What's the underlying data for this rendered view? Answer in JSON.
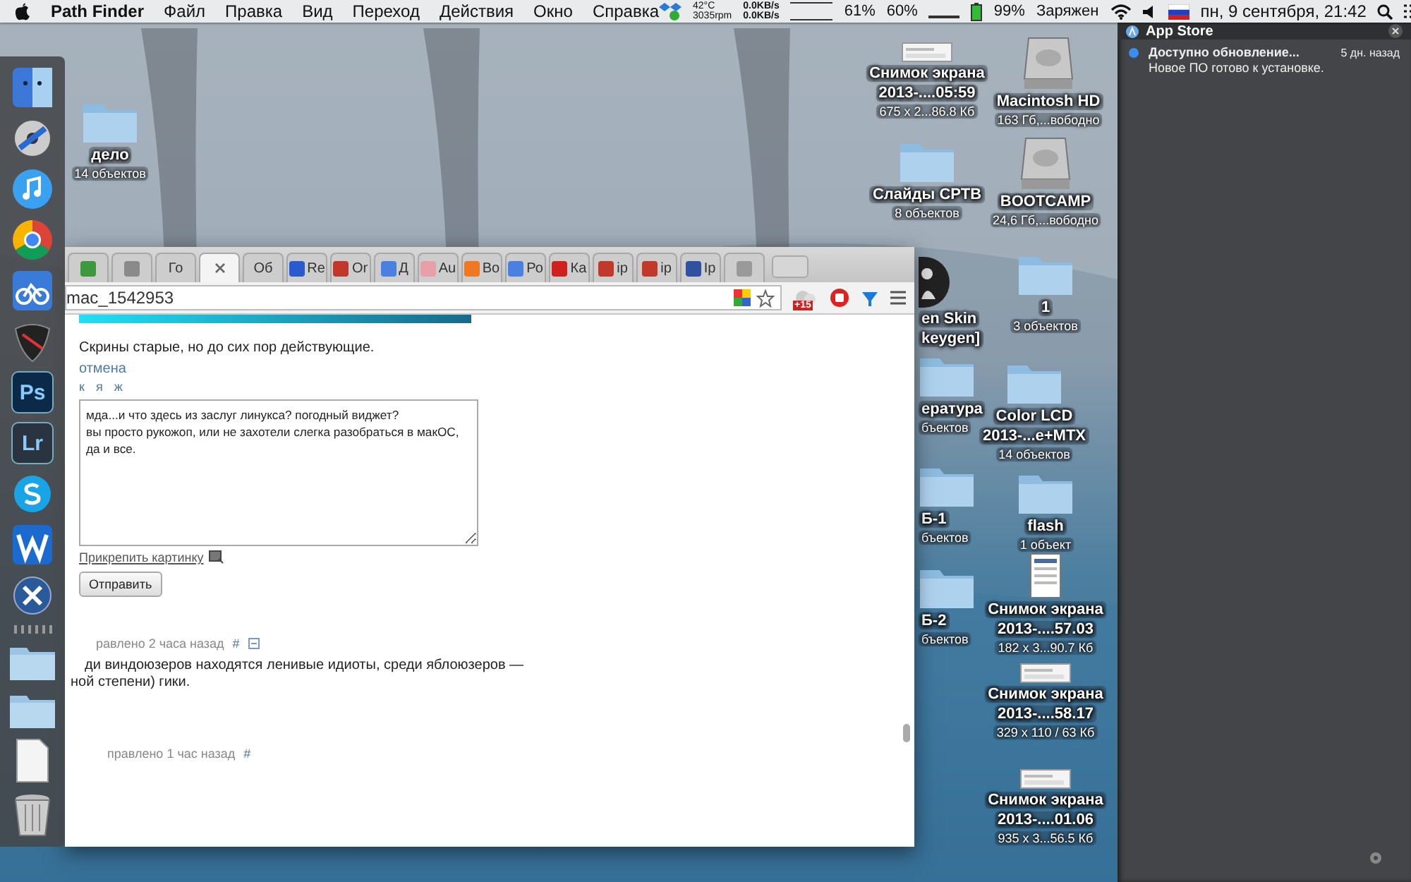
{
  "menubar": {
    "app_name": "Path Finder",
    "menus": [
      "Файл",
      "Правка",
      "Вид",
      "Переход",
      "Действия",
      "Окно",
      "Справка"
    ],
    "status": {
      "temperature": "42°C",
      "fan": "3035rpm",
      "net_up": "0.0KB/s",
      "net_down": "0.0KB/s",
      "disk": "61%",
      "memory": "60%",
      "battery": "99%",
      "battery_state": "Заряжен",
      "clock": "пн, 9 сентября, 21:42"
    }
  },
  "dock": [
    {
      "kind": "finder"
    },
    {
      "kind": "disc"
    },
    {
      "kind": "itunes"
    },
    {
      "kind": "chrome"
    },
    {
      "kind": "bike"
    },
    {
      "kind": "guitar"
    },
    {
      "kind": "letters",
      "glyph": "Ps",
      "color": "#0b2a4a"
    },
    {
      "kind": "letters",
      "glyph": "Lr",
      "color": "#2a3440"
    },
    {
      "kind": "skype"
    },
    {
      "kind": "wave"
    },
    {
      "kind": "xcircle"
    },
    {
      "kind": "separator"
    },
    {
      "kind": "folder"
    },
    {
      "kind": "folder"
    },
    {
      "kind": "file"
    },
    {
      "kind": "trash"
    }
  ],
  "desktop_icons": [
    {
      "kind": "folder",
      "name_lines": [
        "дело"
      ],
      "info": "14 объектов"
    },
    {
      "kind": "screenshot",
      "name_lines": [
        "Снимок экрана",
        "2013-....05:59"
      ],
      "info": "675 x 2...86.8 Кб"
    },
    {
      "kind": "drive",
      "name_lines": [
        "Macintosh HD"
      ],
      "info": "163 Гб,...вободно"
    },
    {
      "kind": "folder",
      "name_lines": [
        "Слайды СРТВ"
      ],
      "info": "8 объектов"
    },
    {
      "kind": "drive",
      "name_lines": [
        "BOOTCAMP"
      ],
      "info": "24,6 Гб,...вободно"
    },
    {
      "kind": "folder",
      "name_lines": [
        "1"
      ],
      "info": "3 объектов"
    },
    {
      "kind": "folder",
      "name_lines": [
        "Color LCD",
        "2013-...e+MTX"
      ],
      "info": "14 объектов"
    },
    {
      "kind": "folder",
      "name_lines": [
        "flash"
      ],
      "info": "1 объект"
    },
    {
      "kind": "document",
      "name_lines": [
        "Снимок экрана",
        "2013-....57.03"
      ],
      "info": "182 x 3...90.7 Кб"
    },
    {
      "kind": "screenshot",
      "name_lines": [
        "Снимок экрана",
        "2013-....58.17"
      ],
      "info": "329 x 110 / 63 Кб"
    },
    {
      "kind": "screenshot",
      "name_lines": [
        "Снимок экрана",
        "2013-....01.06"
      ],
      "info": "935 x 3...56.5 Кб"
    }
  ],
  "partly_hidden_icons": [
    {
      "kind": "avatar",
      "name_lines": [
        "en Skin",
        "keygen]"
      ]
    },
    {
      "kind": "folder",
      "name_lines": [
        "ература"
      ],
      "info": "бъектов"
    },
    {
      "kind": "folder",
      "name_lines": [
        "Б-1"
      ],
      "info": "бъектов"
    },
    {
      "kind": "folder",
      "name_lines": [
        "Б-2"
      ],
      "info": "бъектов"
    }
  ],
  "browser": {
    "tabs": [
      {
        "color": "#3c9a3c",
        "selected": false
      },
      {
        "color": "#8a8a8a",
        "selected": false
      },
      {
        "label": "Го",
        "selected": false
      },
      {
        "selected": true
      },
      {
        "label": "Об",
        "selected": false
      },
      {
        "label": "Re",
        "color": "#2a5ad0",
        "selected": false
      },
      {
        "label": "Or",
        "color": "#c0392b",
        "selected": false
      },
      {
        "label": "Д",
        "color": "#4a80e0",
        "selected": false
      },
      {
        "label": "Au",
        "color": "#e8a0a8",
        "selected": false
      },
      {
        "label": "Во",
        "color": "#f07820",
        "selected": false
      },
      {
        "label": "Ро",
        "color": "#4a80e0",
        "selected": false
      },
      {
        "label": "Ка",
        "color": "#d02020",
        "selected": false
      },
      {
        "label": "ip",
        "color": "#c0392b",
        "selected": false
      },
      {
        "label": "ip",
        "color": "#c0392b",
        "selected": false
      },
      {
        "label": "Ip",
        "color": "#3050a0",
        "selected": false
      },
      {
        "color": "#9a9a9a",
        "selected": false
      }
    ],
    "address": "mac_1542953",
    "weather_badge": "+15",
    "page": {
      "intro": "Скрины старые, но до сих пор действующие.",
      "cancel_link": "отмена",
      "format_buttons": [
        "к",
        "я",
        "ж"
      ],
      "reply_text": "мда...и что здесь из заслуг линукса? погодный виджет?\nвы просто рукожоп, или не захотели слегка разобраться в макОС,\nда и все.",
      "attach_link": "Прикрепить картинку",
      "submit": "Отправить",
      "comments": [
        {
          "meta": "равлено 2 часа назад",
          "anchor": "#",
          "collapse": true,
          "lines": [
            "ди виндоюзеров находятся ленивые идиоты, среди яблоюзеров —",
            "ной степени) гики."
          ]
        },
        {
          "meta": "правлено 1 час назад",
          "anchor": "#",
          "collapse": false
        }
      ]
    }
  },
  "notifications": {
    "app": "App Store",
    "items": [
      {
        "title": "Доступно обновление...",
        "time": "5 дн. назад",
        "body": "Новое ПО готово к установке."
      }
    ]
  }
}
